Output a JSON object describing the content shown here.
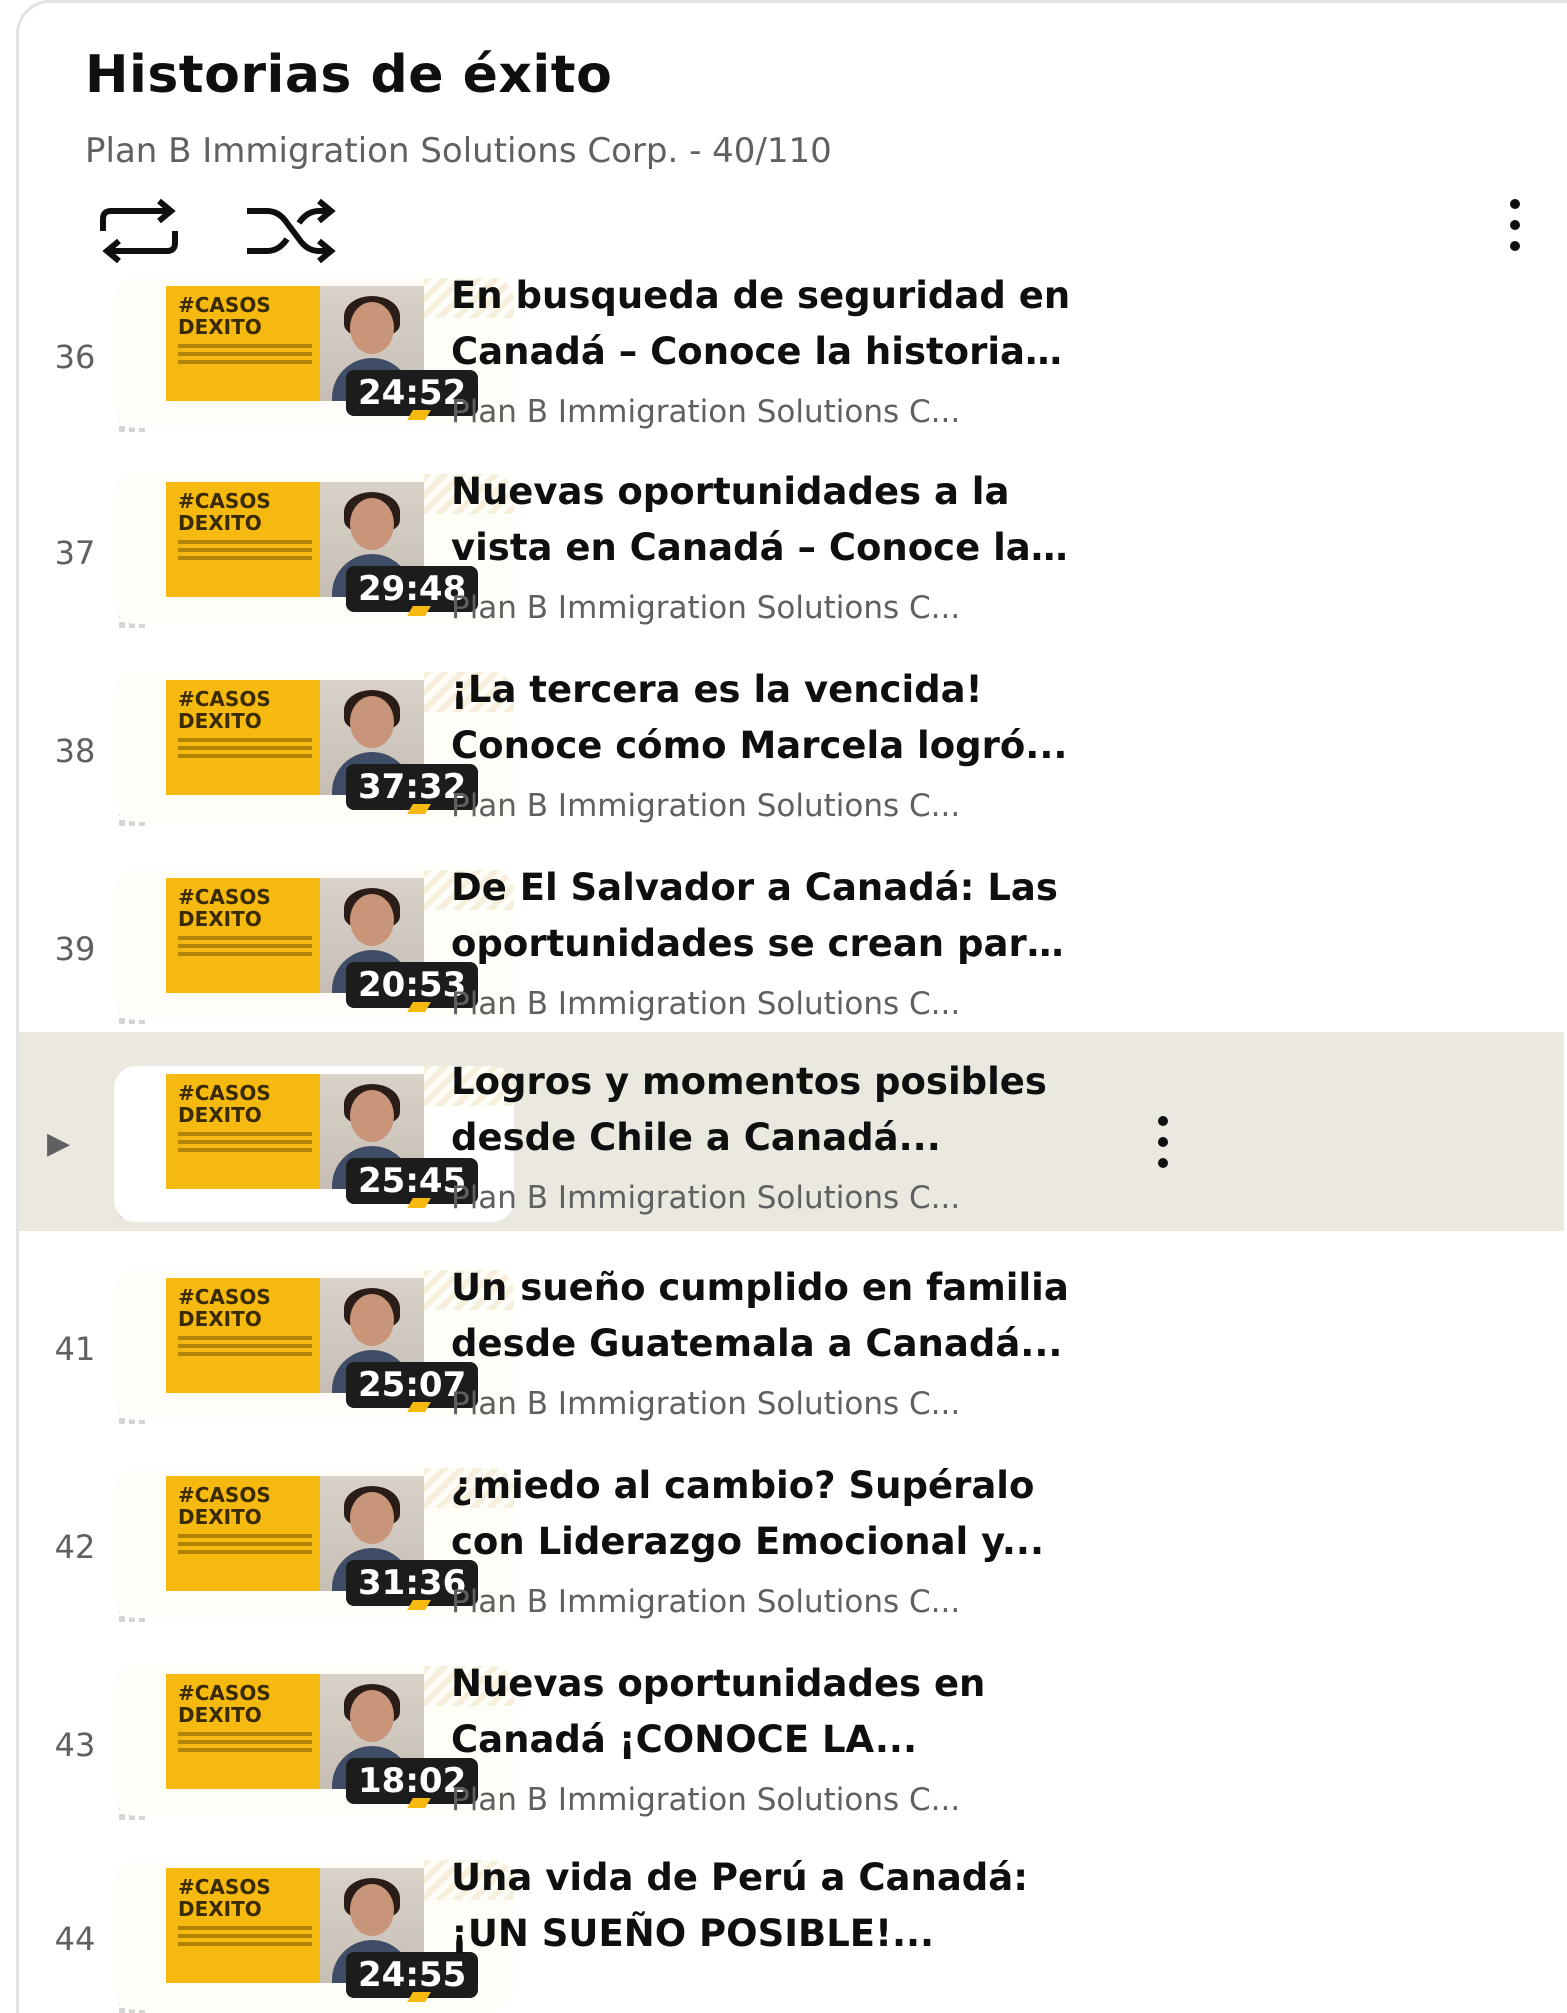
{
  "header": {
    "title": "Historias de éxito",
    "subtitle": "Plan B Immigration Solutions Corp. - 40/110",
    "loop_icon": "repeat-icon",
    "shuffle_icon": "shuffle-icon",
    "menu_icon": "more-vert-icon"
  },
  "colors": {
    "selected_bg": "#ebe8df",
    "poster_yellow": "#f6b90f",
    "duration_bg": "#1c1c1c",
    "secondary_text": "#606060"
  },
  "items": [
    {
      "index": "36",
      "title_line1": "En busqueda de seguridad en",
      "title_line2": "Canadá – Conoce la historia ...",
      "channel": "Plan B Immigration Solutions C...",
      "duration": "24:52",
      "poster_text": "#CASOS DEXITO"
    },
    {
      "index": "37",
      "title_line1": "Nuevas oportunidades a la",
      "title_line2": "vista en Canadá – Conoce la...",
      "channel": "Plan B Immigration Solutions C...",
      "duration": "29:48",
      "poster_text": "#CASOS DEXITO"
    },
    {
      "index": "38",
      "title_line1": "¡La tercera es la vencida!",
      "title_line2": "Conoce cómo Marcela logró...",
      "channel": "Plan B Immigration Solutions C...",
      "duration": "37:32",
      "poster_text": "#CASOS DEXITO"
    },
    {
      "index": "39",
      "title_line1": "De El Salvador a Canadá: Las",
      "title_line2": "oportunidades se crean para...",
      "channel": "Plan B Immigration Solutions C...",
      "duration": "20:53",
      "poster_text": "#CASOS DEXITO"
    },
    {
      "index": "▶",
      "title_line1": "Logros y momentos posibles",
      "title_line2": "desde Chile a Canadá...",
      "channel": "Plan B Immigration Solutions C...",
      "duration": "25:45",
      "poster_text": "#CASOS DEXITO"
    },
    {
      "index": "41",
      "title_line1": "Un sueño cumplido en familia",
      "title_line2": "desde Guatemala a Canadá...",
      "channel": "Plan B Immigration Solutions C...",
      "duration": "25:07",
      "poster_text": "#CASOS DEXITO"
    },
    {
      "index": "42",
      "title_line1": "¿miedo al cambio? Supéralo",
      "title_line2": "con Liderazgo Emocional y...",
      "channel": "Plan B Immigration Solutions C...",
      "duration": "31:36",
      "poster_text": "#CASOS DEXITO"
    },
    {
      "index": "43",
      "title_line1": "Nuevas oportunidades en",
      "title_line2": "Canadá ¡CONOCE LA...",
      "channel": "Plan B Immigration Solutions C...",
      "duration": "18:02",
      "poster_text": "#CASOS DEXITO"
    },
    {
      "index": "44",
      "title_line1": "Una vida de Perú a Canadá:",
      "title_line2": "¡UN SUEÑO POSIBLE!...",
      "channel": "",
      "duration": "24:55",
      "poster_text": "#CASOS DEXITO"
    }
  ]
}
